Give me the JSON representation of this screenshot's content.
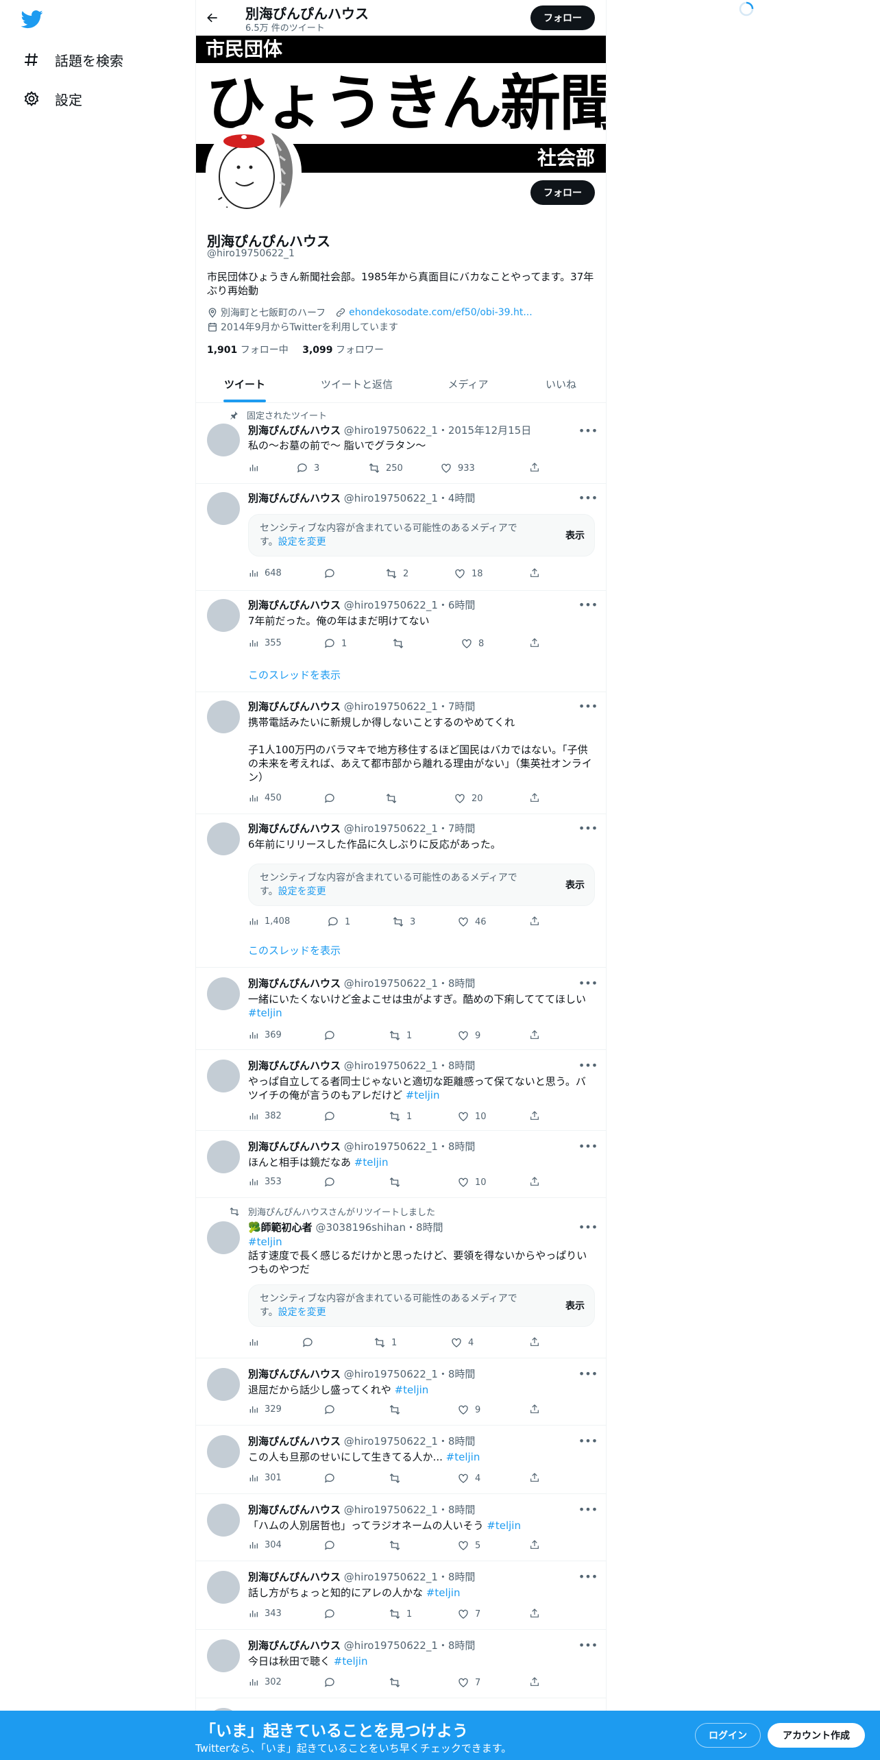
{
  "nav": {
    "logo": "twitter-bird-icon",
    "items": [
      {
        "label": "話題を検索",
        "icon": "hashtag-icon"
      },
      {
        "label": "設定",
        "icon": "gear-icon"
      }
    ]
  },
  "header": {
    "name": "別海ぴんぴんハウス",
    "tweet_count": "6.5万 件のツイート",
    "follow": "フォロー"
  },
  "banner": {
    "top": "市民団体",
    "title": "ひょうきん新聞",
    "bottom": "社会部"
  },
  "profile": {
    "name": "別海ぴんぴんハウス",
    "handle": "@hiro19750622_1",
    "bio": "市民団体ひょうきん新聞社会部。1985年から真面目にバカなことやってます。37年ぶり再始動",
    "location": "別海町と七飯町のハーフ",
    "url": "ehondekosodate.com/ef50/obi-39.ht...",
    "joined": "2014年9月からTwitterを利用しています",
    "following_count": "1,901",
    "following_label": "フォロー中",
    "followers_count": "3,099",
    "followers_label": "フォロワー",
    "follow": "フォロー"
  },
  "tabs": [
    "ツイート",
    "ツイートと返信",
    "メディア",
    "いいね"
  ],
  "sensitive": {
    "text": "センシティブな内容が含まれている可能性のあるメディアです。",
    "link": "設定を変更",
    "show": "表示"
  },
  "thread_link": "このスレッドを表示",
  "tweets": [
    {
      "context": "固定されたツイート",
      "name": "別海ぴんぴんハウス",
      "meta": "@hiro19750622_1・2015年12月15日",
      "text": "私の〜お墓の前で〜 脂いでグラタン〜",
      "views": "",
      "replies": "3",
      "retweets": "250",
      "likes": "933"
    },
    {
      "name": "別海ぴんぴんハウス",
      "meta": "@hiro19750622_1・4時間",
      "views": "648",
      "replies": "",
      "retweets": "2",
      "likes": "18"
    },
    {
      "name": "別海ぴんぴんハウス",
      "meta": "@hiro19750622_1・6時間",
      "text": "7年前だった。俺の年はまだ明けてない",
      "views": "355",
      "replies": "1",
      "retweets": "",
      "likes": "8"
    },
    {
      "name": "別海ぴんぴんハウス",
      "meta": "@hiro19750622_1・7時間",
      "text": "携帯電話みたいに新規しか得しないことするのやめてくれ",
      "text2": "子1人100万円のバラマキで地方移住するほど国民はバカではない。「子供の未来を考えれば、あえて都市部から離れる理由がない」（集英社オンライン）",
      "views": "450",
      "replies": "",
      "retweets": "",
      "likes": "20"
    },
    {
      "name": "別海ぴんぴんハウス",
      "meta": "@hiro19750622_1・7時間",
      "text": "6年前にリリースした作品に久しぶりに反応があった。",
      "views": "1,408",
      "replies": "1",
      "retweets": "3",
      "likes": "46"
    },
    {
      "name": "別海ぴんぴんハウス",
      "meta": "@hiro19750622_1・8時間",
      "text": "一緒にいたくないけど金よこせは虫がよすぎ。酷めの下痢してててほしい",
      "tag": "#teljin",
      "views": "369",
      "replies": "",
      "retweets": "1",
      "likes": "9"
    },
    {
      "name": "別海ぴんぴんハウス",
      "meta": "@hiro19750622_1・8時間",
      "text": "やっぱ自立してる者同士じゃないと適切な距離感って保てないと思う。バツイチの俺が言うのもアレだけど",
      "tag": "#teljin",
      "views": "382",
      "replies": "",
      "retweets": "1",
      "likes": "10"
    },
    {
      "name": "別海ぴんぴんハウス",
      "meta": "@hiro19750622_1・8時間",
      "text": "ほんと相手は鏡だなあ",
      "tag": "#teljin",
      "views": "353",
      "replies": "",
      "retweets": "",
      "likes": "10"
    },
    {
      "context": "別海ぴんぴんハウスさんがリツイートしました",
      "name": "🥦師範初心者",
      "meta": "@3038196shihan・8時間",
      "tag": "#teljin",
      "text": "話す速度で長く感じるだけかと思ったけど、要領を得ないからやっぱりいつものやつだ",
      "views": "",
      "replies": "",
      "retweets": "1",
      "likes": "4"
    },
    {
      "name": "別海ぴんぴんハウス",
      "meta": "@hiro19750622_1・8時間",
      "text": "退屈だから話少し盛ってくれや",
      "tag": "#teljin",
      "views": "329",
      "replies": "",
      "retweets": "",
      "likes": "9"
    },
    {
      "name": "別海ぴんぴんハウス",
      "meta": "@hiro19750622_1・8時間",
      "text": "この人も旦那のせいにして生きてる人か...",
      "tag": "#teljin",
      "views": "301",
      "replies": "",
      "retweets": "",
      "likes": "4"
    },
    {
      "name": "別海ぴんぴんハウス",
      "meta": "@hiro19750622_1・8時間",
      "text": "「ハムの人別居哲也」ってラジオネームの人いそう",
      "tag": "#teljin",
      "views": "304",
      "replies": "",
      "retweets": "",
      "likes": "5"
    },
    {
      "name": "別海ぴんぴんハウス",
      "meta": "@hiro19750622_1・8時間",
      "text": "話し方がちょっと知的にアレの人かな",
      "tag": "#teljin",
      "views": "343",
      "replies": "",
      "retweets": "1",
      "likes": "7"
    },
    {
      "name": "別海ぴんぴんハウス",
      "meta": "@hiro19750622_1・8時間",
      "text": "今日は秋田で聴く",
      "tag": "#teljin",
      "views": "302",
      "replies": "",
      "retweets": "",
      "likes": "7"
    }
  ],
  "bottom_bar": {
    "title": "「いま」起きていることを見つけよう",
    "subtitle": "Twitterなら、「いま」起きていることをいち早くチェックできます。",
    "login": "ログイン",
    "signup": "アカウント作成"
  },
  "colors": {
    "accent": "#1d9bf0",
    "text": "#0f1419",
    "muted": "#536471",
    "bottom_bar": "#1d9bf0"
  }
}
